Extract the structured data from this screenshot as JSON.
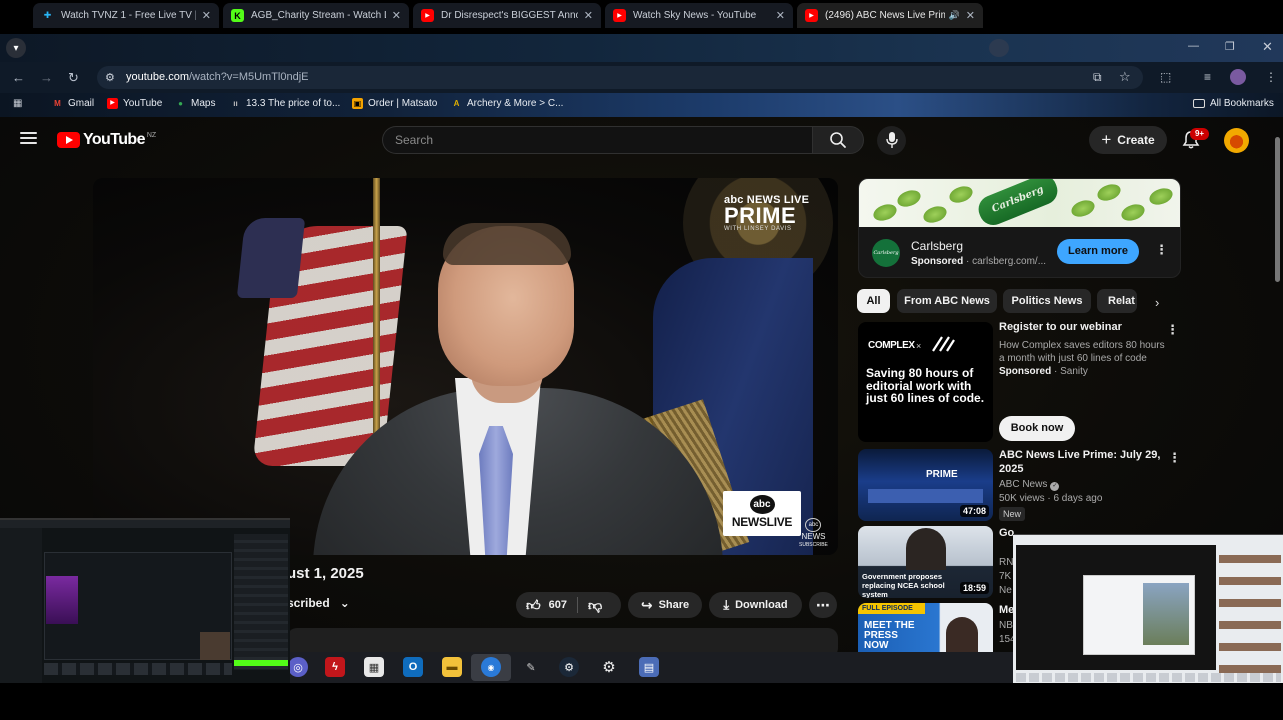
{
  "browser": {
    "tabs": [
      {
        "title": "Watch TVNZ 1 - Free Live TV | T",
        "favicon_color": "#29b6f6",
        "favicon": "✚",
        "active": false
      },
      {
        "title": "AGB_Charity Stream - Watch Li",
        "favicon_color": "#53fc18",
        "favicon": "K",
        "active": false
      },
      {
        "title": "Dr Disrespect's BIGGEST Anno",
        "favicon_color": "#ff0000",
        "favicon": "▶",
        "active": false
      },
      {
        "title": "Watch Sky News - YouTube",
        "favicon_color": "#ff0000",
        "favicon": "▶",
        "active": false
      },
      {
        "title": "(2496) ABC News Live Prime",
        "favicon_color": "#ff0000",
        "favicon": "▶",
        "active": true
      }
    ],
    "url_host": "youtube.com",
    "url_path": "/watch?v=M5UmTl0ndjE",
    "bookmarks": [
      {
        "label": "Gmail",
        "color": "#ea4335",
        "glyph": "M"
      },
      {
        "label": "YouTube",
        "color": "#ff0000",
        "glyph": "▶"
      },
      {
        "label": "Maps",
        "color": "#34a853",
        "glyph": "●"
      },
      {
        "label": "13.3 The price of to...",
        "color": "#888888",
        "glyph": "ıı"
      },
      {
        "label": "Order | Matsato",
        "color": "#f4a300",
        "glyph": "▣"
      },
      {
        "label": "Archery & More > C...",
        "color": "#e0b000",
        "glyph": "A"
      }
    ],
    "all_bookmarks": "All Bookmarks"
  },
  "youtube": {
    "logo_word": "YouTube",
    "country": "NZ",
    "search_placeholder": "Search",
    "create_label": "Create",
    "notification_count": "9+",
    "video": {
      "overlay_brand_top": "abc NEWS LIVE",
      "overlay_brand_main": "PRIME",
      "overlay_brand_sub": "WITH LINSEY DAVIS",
      "bug_abc": "abc",
      "bug_newslive": "NEWSLIVE",
      "bug_subscribe": "SUBSCRIBE",
      "bug_news": "NEWS",
      "title_visible": "ust 1, 2025",
      "subscribed_label": "scribed",
      "likes": "607",
      "share_label": "Share",
      "download_label": "Download"
    },
    "sidebar": {
      "ad": {
        "banner_text": "Carlsberg",
        "advertiser": "Carlsberg",
        "sponsored": "Sponsored",
        "domain": "carlsberg.com/...",
        "cta": "Learn more"
      },
      "chips": [
        "All",
        "From ABC News",
        "Politics News",
        "Relat"
      ],
      "ad2": {
        "thumb_brand": "COMPLEX",
        "thumb_times": "×",
        "thumb_text": "Saving 80 hours of editorial work with just 60 lines of code.",
        "title": "Register to our webinar",
        "desc": "How Complex saves editors 80 hours a month with just 60 lines of code",
        "sponsored": "Sponsored",
        "advertiser": "Sanity",
        "cta": "Book now"
      },
      "videos": [
        {
          "title": "ABC News Live Prime: July 29, 2025",
          "channel": "ABC News",
          "meta": "50K views · 6 days ago",
          "badge": "New",
          "duration": "47:08"
        },
        {
          "title": "Go",
          "channel": "RN",
          "meta": "7K",
          "sub": "Ne",
          "thumb_caption": "Government proposes replacing NCEA school system",
          "duration": "18:59"
        },
        {
          "title": "Me",
          "channel": "NB",
          "meta": "154",
          "thumb_tag": "FULL EPISODE",
          "thumb_show": "MEET THE PRESS NOW"
        }
      ]
    }
  }
}
